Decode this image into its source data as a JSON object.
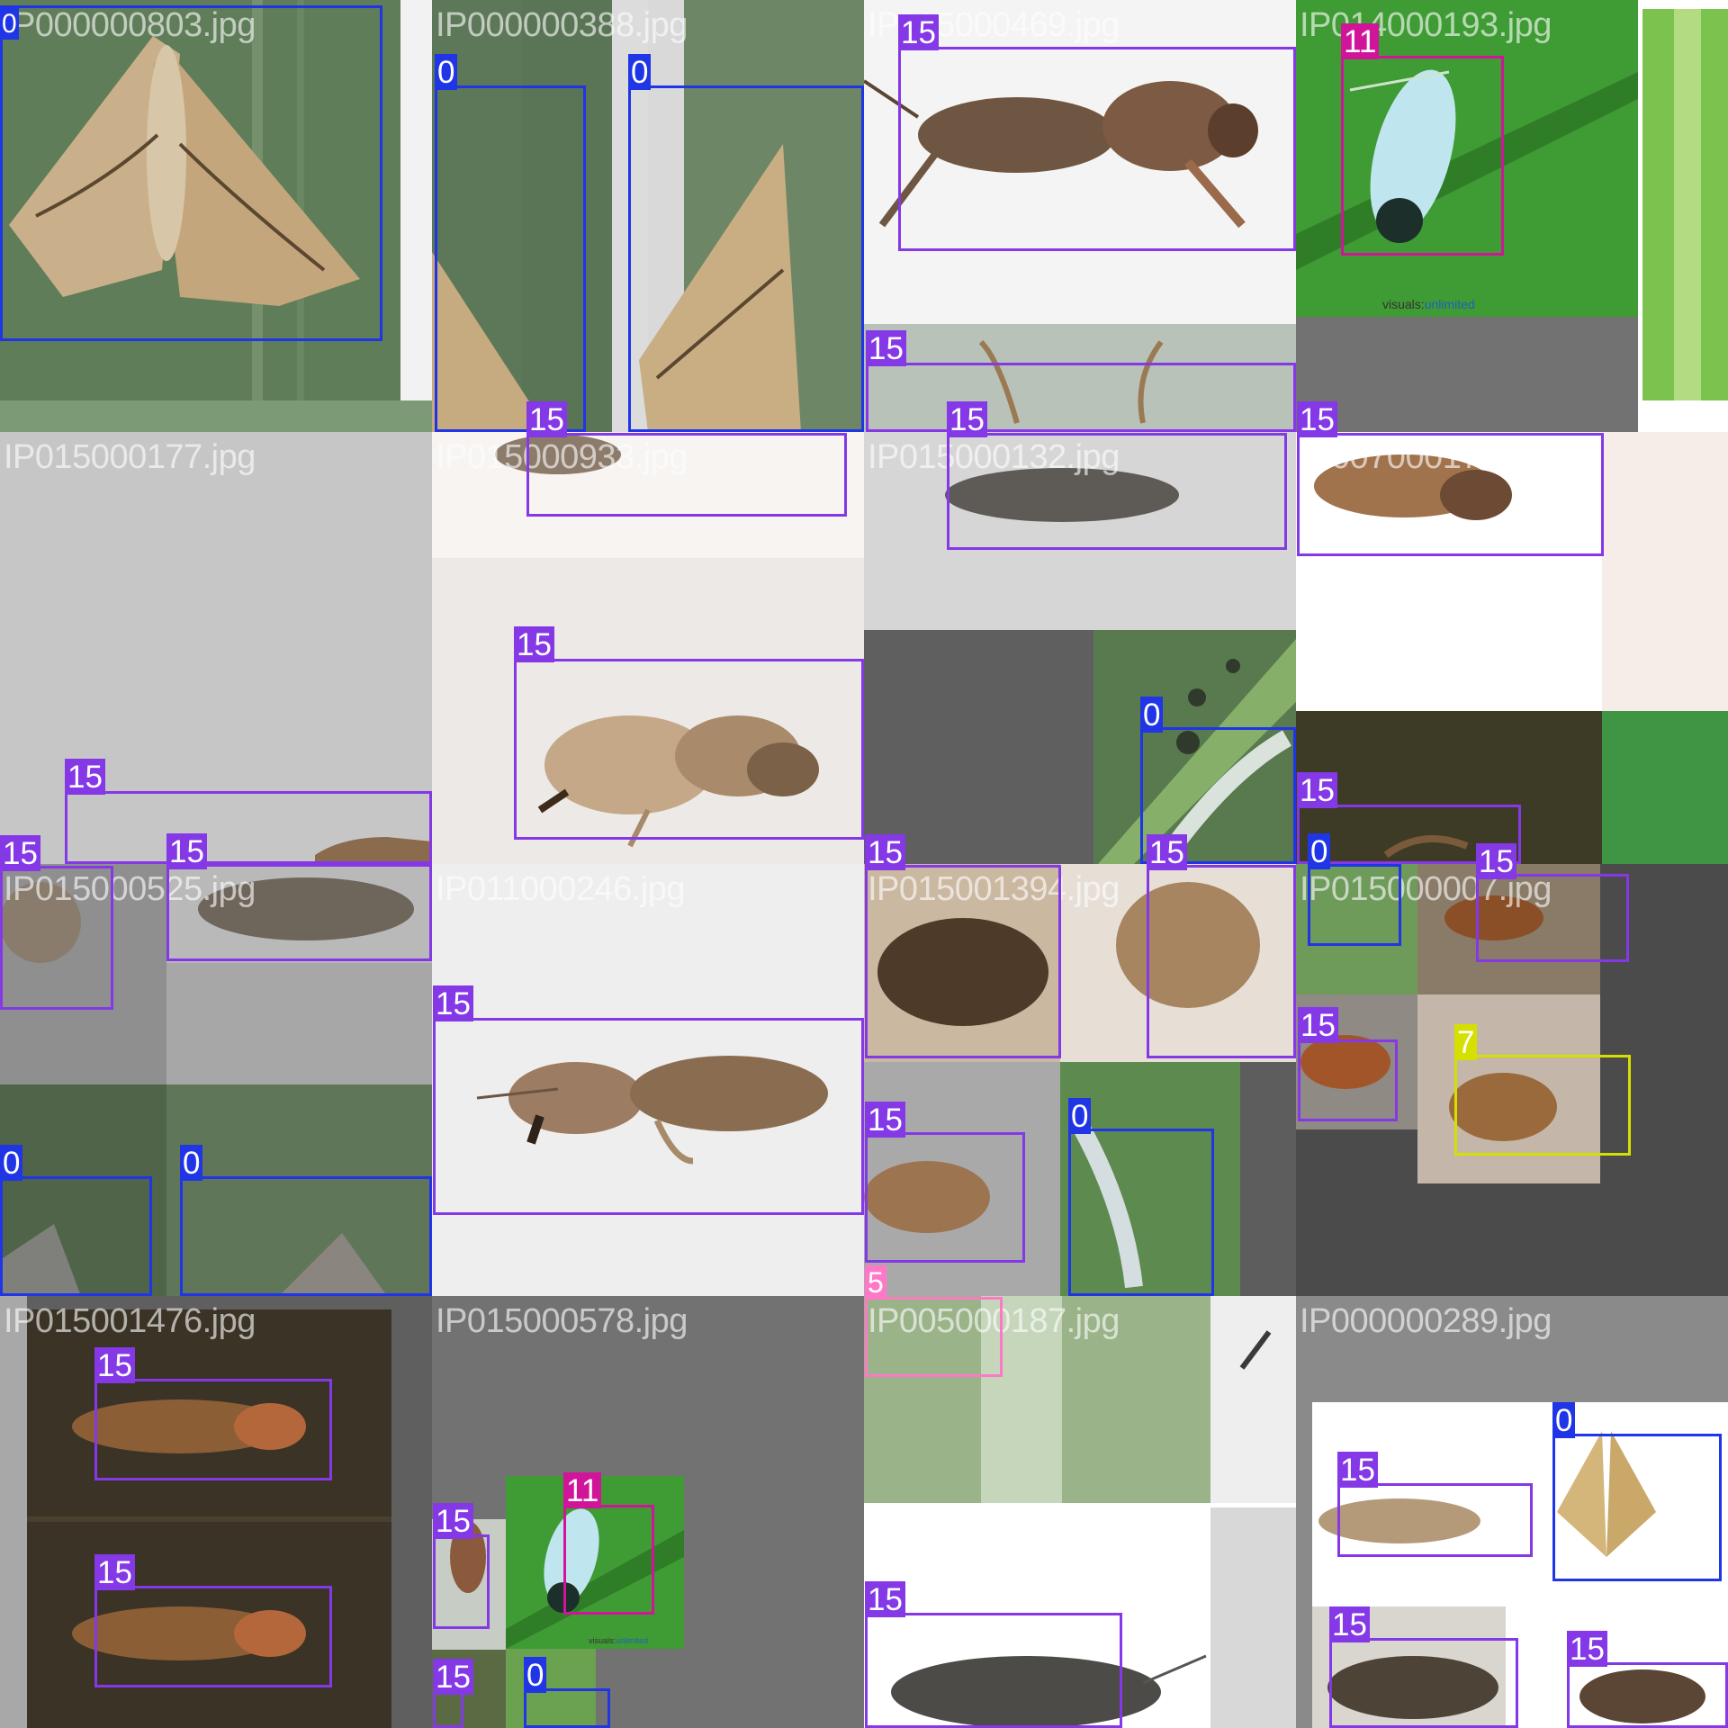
{
  "colors": {
    "0": "#1f35e6",
    "5": "#ff78c8",
    "7": "#d6e000",
    "11": "#d1159a",
    "15": "#8438e6",
    "letterbox": "#727272",
    "label_text": "#ffffff"
  },
  "tiles": [
    {
      "name": "IP000000803.jpg"
    },
    {
      "name": "IP000000388.jpg"
    },
    {
      "name": "IP015000469.jpg"
    },
    {
      "name": "IP014000193.jpg"
    },
    {
      "name": "IP015000177.jpg"
    },
    {
      "name": "IP015000933.jpg"
    },
    {
      "name": "IP015000132.jpg"
    },
    {
      "name": "IP007000172.jpg"
    },
    {
      "name": "IP015000525.jpg"
    },
    {
      "name": "IP011000246.jpg"
    },
    {
      "name": "IP015001394.jpg"
    },
    {
      "name": "IP015000007.jpg"
    },
    {
      "name": "IP015001476.jpg"
    },
    {
      "name": "IP015000578.jpg"
    },
    {
      "name": "IP005000187.jpg"
    },
    {
      "name": "IP000000289.jpg"
    }
  ],
  "watermarks": {
    "visuals_prefix": "visuals:",
    "visuals_suffix": "unlimited"
  },
  "annotations": [
    {
      "tile": 0,
      "label": "0"
    },
    {
      "tile": 1,
      "label": "0"
    },
    {
      "tile": 1,
      "label": "0"
    },
    {
      "tile": 2,
      "label": "15"
    },
    {
      "tile": 2,
      "label": "15"
    },
    {
      "tile": 3,
      "label": "11"
    },
    {
      "tile": 5,
      "label": "15"
    },
    {
      "tile": 5,
      "label": "15"
    },
    {
      "tile": 6,
      "label": "15"
    },
    {
      "tile": 6,
      "label": "0"
    },
    {
      "tile": 7,
      "label": "15"
    },
    {
      "tile": 7,
      "label": "15"
    },
    {
      "tile": 4,
      "label": "15"
    },
    {
      "tile": 8,
      "label": "15"
    },
    {
      "tile": 8,
      "label": "15"
    },
    {
      "tile": 8,
      "label": "0"
    },
    {
      "tile": 8,
      "label": "0"
    },
    {
      "tile": 9,
      "label": "15"
    },
    {
      "tile": 10,
      "label": "15"
    },
    {
      "tile": 10,
      "label": "15"
    },
    {
      "tile": 10,
      "label": "15"
    },
    {
      "tile": 10,
      "label": "0"
    },
    {
      "tile": 11,
      "label": "0"
    },
    {
      "tile": 11,
      "label": "15"
    },
    {
      "tile": 11,
      "label": "15"
    },
    {
      "tile": 11,
      "label": "7"
    },
    {
      "tile": 12,
      "label": "15"
    },
    {
      "tile": 12,
      "label": "15"
    },
    {
      "tile": 13,
      "label": "11"
    },
    {
      "tile": 13,
      "label": "15"
    },
    {
      "tile": 13,
      "label": "15"
    },
    {
      "tile": 13,
      "label": "0"
    },
    {
      "tile": 14,
      "label": "5"
    },
    {
      "tile": 14,
      "label": "15"
    },
    {
      "tile": 15,
      "label": "0"
    },
    {
      "tile": 15,
      "label": "15"
    },
    {
      "tile": 15,
      "label": "15"
    },
    {
      "tile": 15,
      "label": "15"
    }
  ]
}
